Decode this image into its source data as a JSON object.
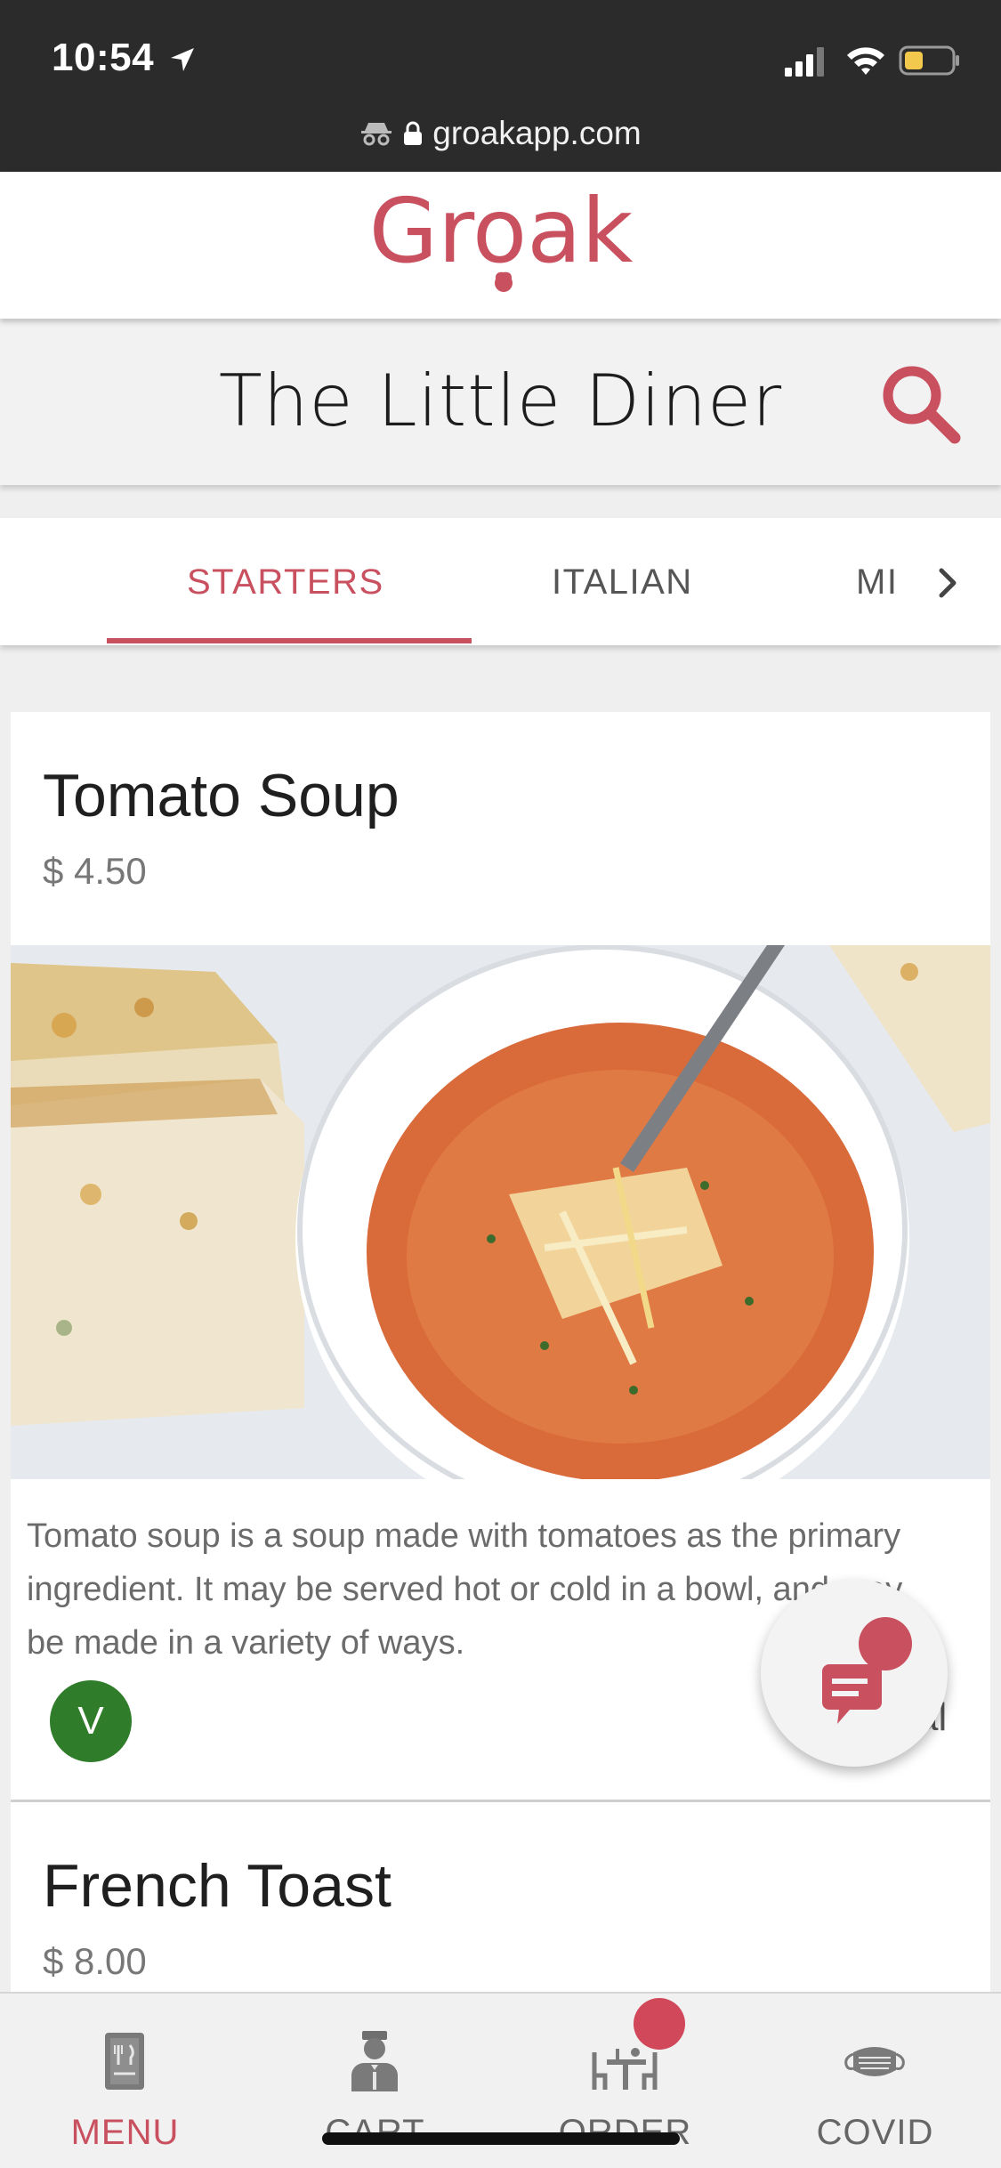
{
  "status_bar": {
    "time": "10:54",
    "url": "groakapp.com"
  },
  "brand": {
    "logo_text": "Groak",
    "brand_color": "#c9505f"
  },
  "restaurant": {
    "name": "The Little Diner"
  },
  "tabs": [
    {
      "label": "STARTERS",
      "active": true
    },
    {
      "label": "ITALIAN",
      "active": false
    },
    {
      "label": "MI",
      "active": false
    }
  ],
  "menu_items": [
    {
      "name": "Tomato Soup",
      "price": "$ 4.50",
      "description": "Tomato soup is a soup made with tomatoes as the primary ingredient. It may be served hot or cold in a bowl, and may be made in a variety of ways.",
      "badge": "V",
      "badge_color": "#2f7d2a",
      "tag_partial": "al"
    },
    {
      "name": "French Toast",
      "price": "$ 8.00"
    }
  ],
  "bottom_nav": [
    {
      "label": "MENU",
      "icon": "menu-book-icon",
      "active": true
    },
    {
      "label": "CART",
      "icon": "waiter-icon",
      "active": false
    },
    {
      "label": "ORDER",
      "icon": "dining-table-icon",
      "active": false,
      "has_notification": true
    },
    {
      "label": "COVID",
      "icon": "face-mask-icon",
      "active": false
    }
  ]
}
